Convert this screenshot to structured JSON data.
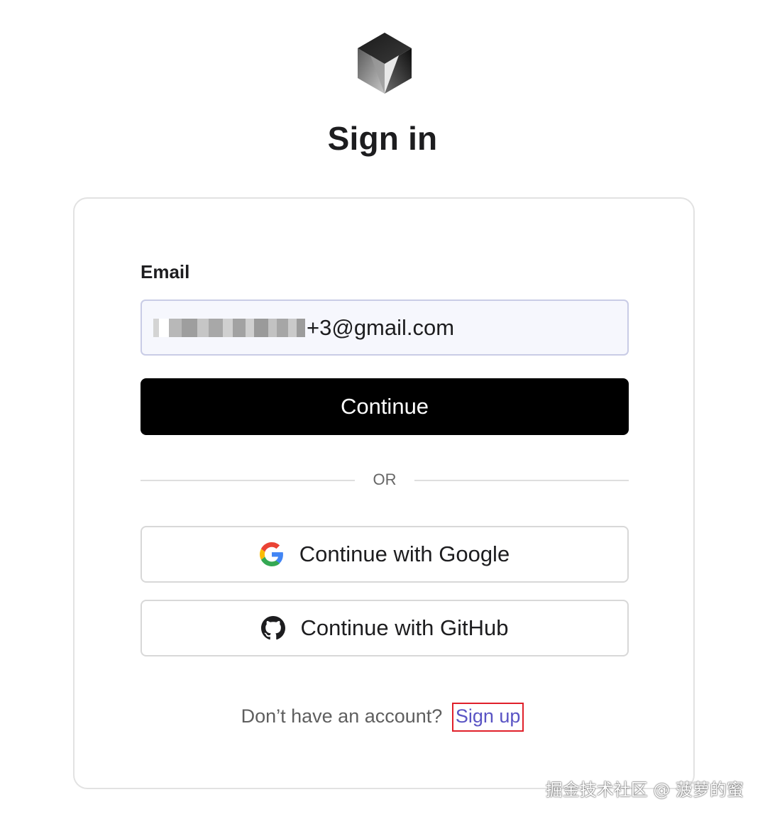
{
  "page": {
    "title": "Sign in"
  },
  "form": {
    "email_label": "Email",
    "email_value_visible": "+3@gmail.com",
    "continue_label": "Continue",
    "divider_text": "OR"
  },
  "social": {
    "google_label": "Continue with Google",
    "github_label": "Continue with GitHub"
  },
  "footer": {
    "prompt": "Don’t have an account?",
    "signup_label": "Sign up"
  },
  "watermark": "掘金技术社区 @ 菠萝的蜜",
  "colors": {
    "primary_button": "#000000",
    "link": "#5a54c4",
    "highlight_box": "#e0202a",
    "input_background": "#f6f7fd"
  },
  "icons": {
    "logo": "cube-logo-icon",
    "google": "google-icon",
    "github": "github-icon"
  }
}
